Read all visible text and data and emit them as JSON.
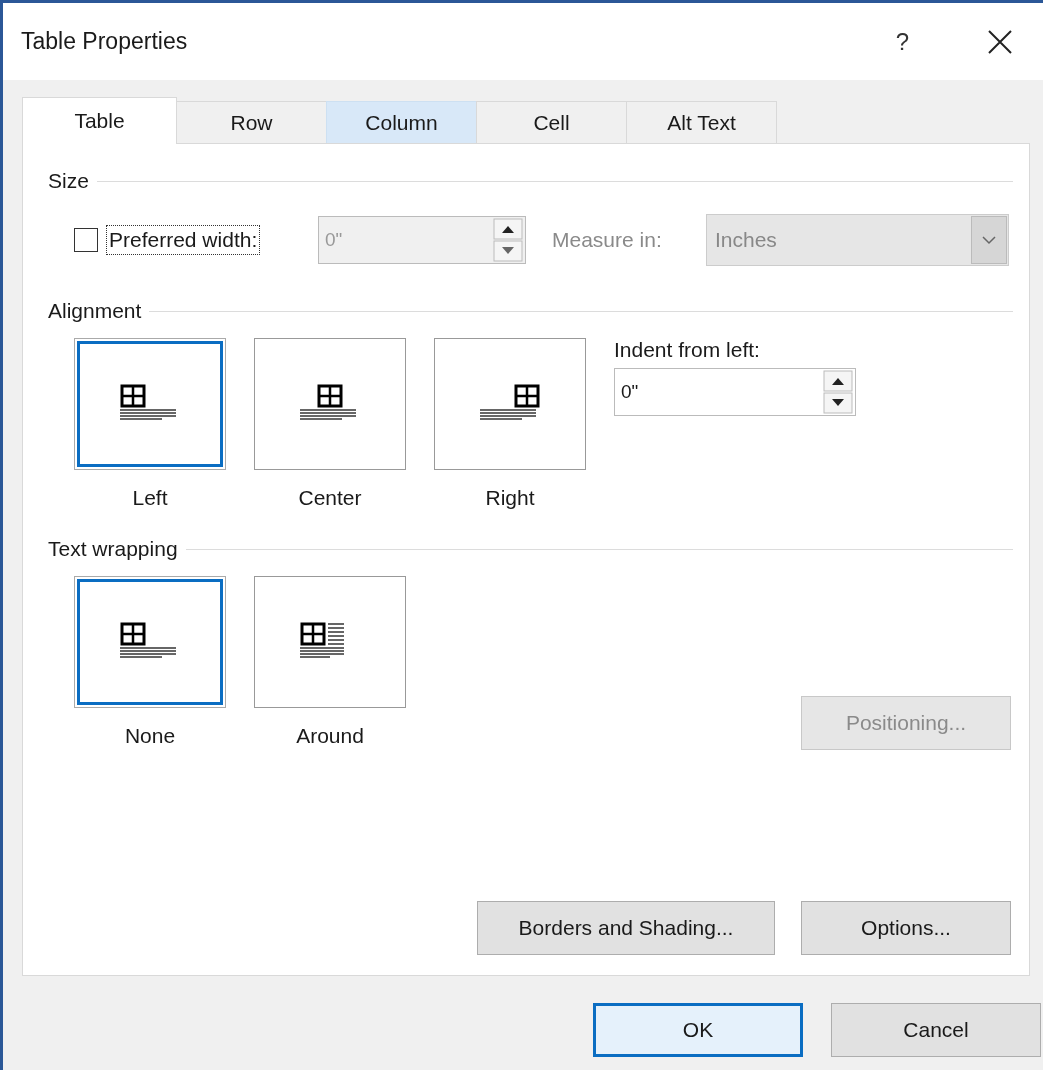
{
  "window": {
    "title": "Table Properties",
    "help_label": "?"
  },
  "tabs": [
    {
      "label": "Table",
      "selected": true,
      "hovered": false
    },
    {
      "label": "Row",
      "selected": false,
      "hovered": false
    },
    {
      "label": "Column",
      "selected": false,
      "hovered": true
    },
    {
      "label": "Cell",
      "selected": false,
      "hovered": false
    },
    {
      "label": "Alt Text",
      "selected": false,
      "hovered": false
    }
  ],
  "size": {
    "heading": "Size",
    "preferred_width": {
      "label": "Preferred width:",
      "checked": false,
      "focused": true,
      "value": "0\"",
      "disabled": true
    },
    "measure_in": {
      "label": "Measure in:",
      "value": "Inches",
      "disabled": true
    }
  },
  "alignment": {
    "heading": "Alignment",
    "options": [
      {
        "label": "Left",
        "kind": "left",
        "selected": true
      },
      {
        "label": "Center",
        "kind": "center",
        "selected": false
      },
      {
        "label": "Right",
        "kind": "right",
        "selected": false
      }
    ],
    "indent": {
      "label": "Indent from left:",
      "value": "0\""
    }
  },
  "text_wrapping": {
    "heading": "Text wrapping",
    "options": [
      {
        "label": "None",
        "kind": "none",
        "selected": true
      },
      {
        "label": "Around",
        "kind": "around",
        "selected": false
      }
    ],
    "positioning": {
      "label": "Positioning...",
      "disabled": true
    }
  },
  "panel_buttons": [
    {
      "label": "Borders and Shading...",
      "disabled": false
    },
    {
      "label": "Options...",
      "disabled": false
    }
  ],
  "footer_buttons": [
    {
      "label": "OK",
      "default": true
    },
    {
      "label": "Cancel",
      "default": false
    }
  ]
}
